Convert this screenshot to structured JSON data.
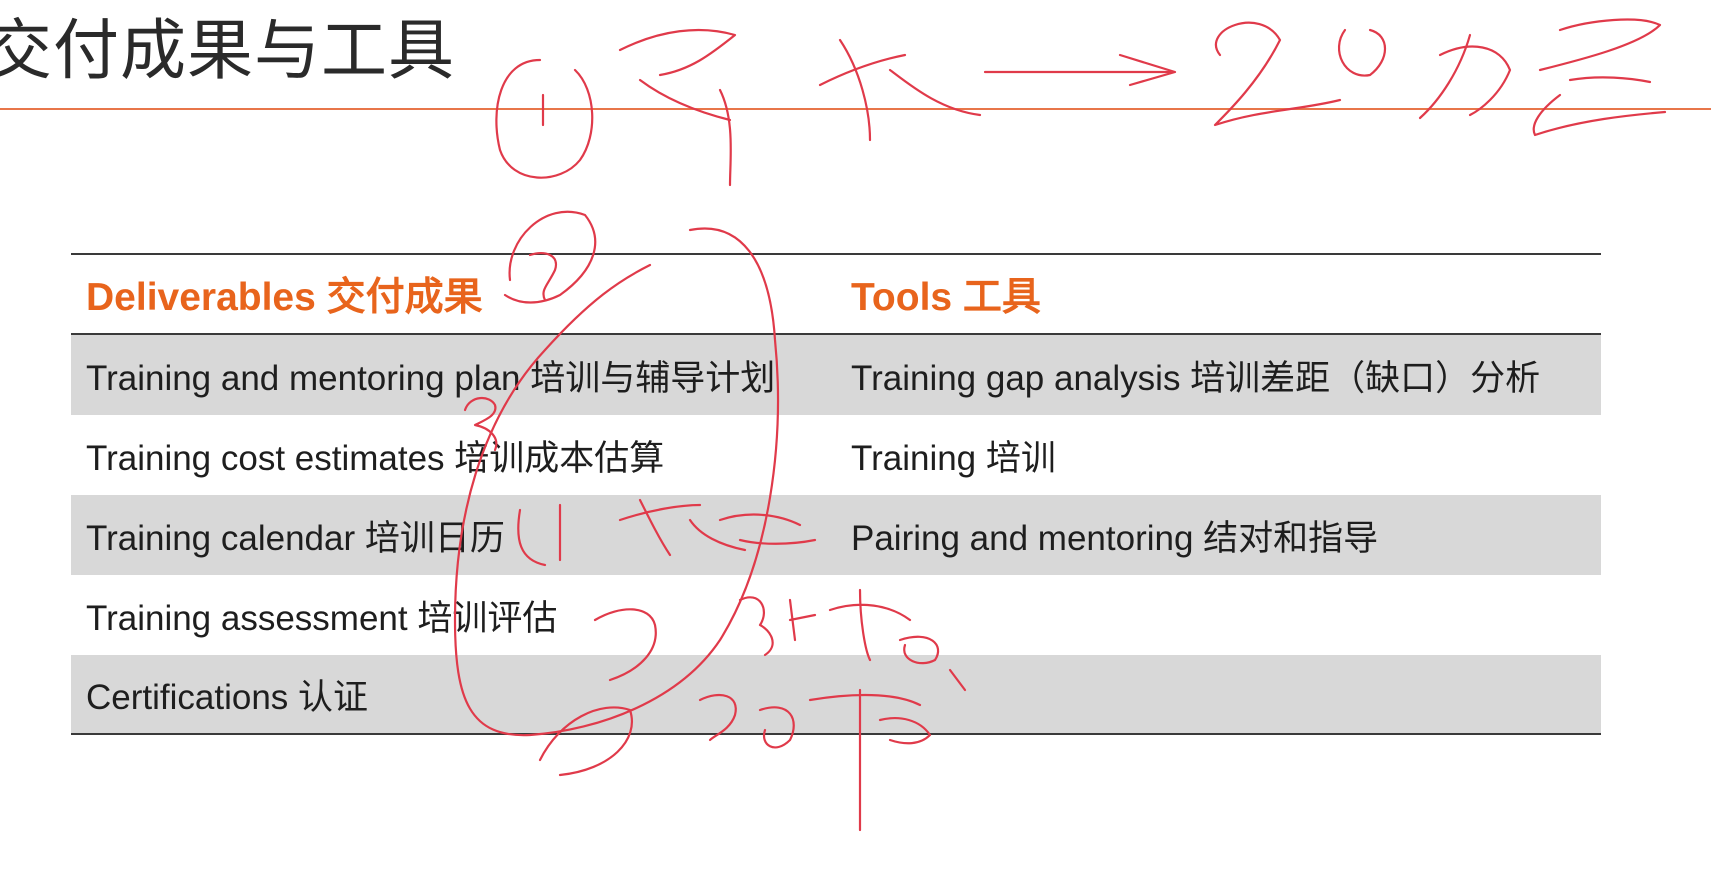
{
  "slide": {
    "title": "交付成果与工具"
  },
  "table": {
    "headers": {
      "deliverables": "Deliverables 交付成果",
      "tools": "Tools 工具"
    },
    "rows": [
      {
        "deliverable": "Training and mentoring plan 培训与辅导计划",
        "tool": "Training gap analysis 培训差距（缺口）分析"
      },
      {
        "deliverable": "Training cost estimates 培训成本估算",
        "tool": "Training 培训"
      },
      {
        "deliverable": "Training calendar 培训日历",
        "tool": "Pairing and mentoring 结对和指导"
      },
      {
        "deliverable": "Training assessment 培训评估",
        "tool": ""
      },
      {
        "deliverable": "Certifications 认证",
        "tool": ""
      }
    ]
  },
  "colors": {
    "accent": "#e8641c",
    "rule": "#e8764a",
    "row_shade": "#d8d8d8",
    "ink": "#e03a4a"
  }
}
